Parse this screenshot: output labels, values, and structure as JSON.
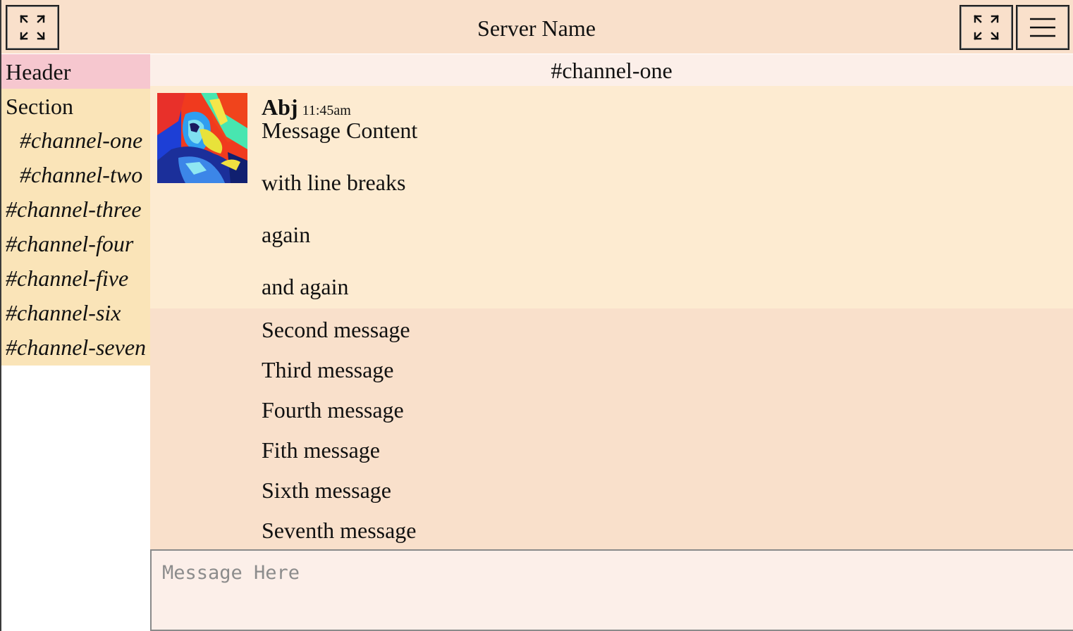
{
  "topbar": {
    "server_name": "Server Name",
    "left_button_icon": "expand-icon",
    "right_button_icon": "expand-icon",
    "menu_button_icon": "hamburger-menu-icon"
  },
  "sidebar": {
    "header": "Header",
    "section": "Section",
    "channels": [
      "#channel-one",
      "#channel-two",
      "#channel-three",
      "#channel-four",
      "#channel-five",
      "#channel-six",
      "#channel-seven"
    ]
  },
  "main": {
    "channel_title": "#channel-one",
    "first_message": {
      "author": "Abj",
      "time": "11:45am",
      "lines": [
        "Message Content",
        "",
        "with line breaks",
        "",
        "again",
        "",
        "and again"
      ]
    },
    "messages": [
      "Second message",
      "Third message",
      "Fourth message",
      "Fith message",
      "Sixth message",
      "Seventh message"
    ],
    "composer": {
      "placeholder": "Message Here",
      "value": ""
    }
  },
  "colors": {
    "topbar_bg": "#f9e0cb",
    "sidebar_header_bg": "#f6c7cf",
    "sidebar_bg": "#fae4b8",
    "channel_bar_bg": "#fcefe9",
    "first_message_bg": "#fdebd1",
    "message_group_bg": "#f9e0cb",
    "composer_bg": "#fcefe9"
  }
}
